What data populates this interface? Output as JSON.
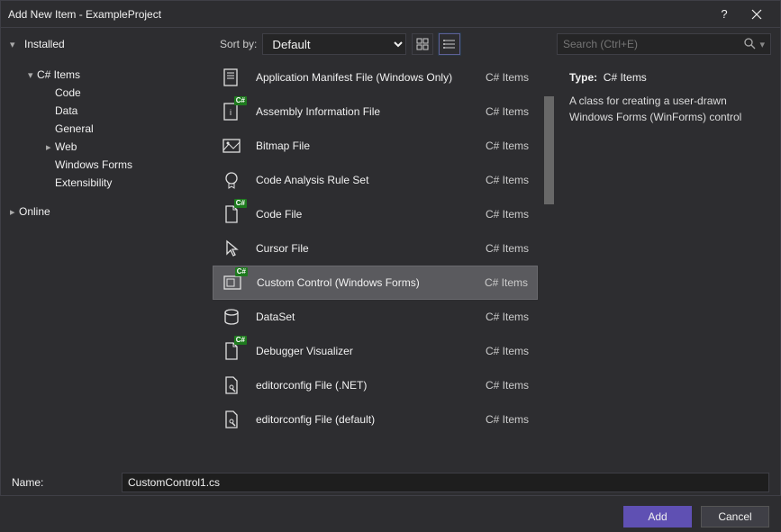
{
  "window": {
    "title": "Add New Item - ExampleProject"
  },
  "toolbar": {
    "installed_label": "Installed",
    "sort_label": "Sort by:",
    "sort_value": "Default",
    "search_placeholder": "Search (Ctrl+E)"
  },
  "tree": {
    "items": [
      {
        "label": "C# Items",
        "level": "h1",
        "arrow": "▾"
      },
      {
        "label": "Code",
        "level": "h2",
        "arrow": ""
      },
      {
        "label": "Data",
        "level": "h2",
        "arrow": ""
      },
      {
        "label": "General",
        "level": "h2",
        "arrow": ""
      },
      {
        "label": "Web",
        "level": "h2",
        "arrow": "▸"
      },
      {
        "label": "Windows Forms",
        "level": "h2",
        "arrow": ""
      },
      {
        "label": "Extensibility",
        "level": "h2",
        "arrow": ""
      }
    ],
    "online_label": "Online"
  },
  "templates": [
    {
      "label": "Application Manifest File (Windows Only)",
      "cat": "C# Items",
      "icon": "manifest",
      "cs": false
    },
    {
      "label": "Assembly Information File",
      "cat": "C# Items",
      "icon": "assembly",
      "cs": true
    },
    {
      "label": "Bitmap File",
      "cat": "C# Items",
      "icon": "bitmap",
      "cs": false
    },
    {
      "label": "Code Analysis Rule Set",
      "cat": "C# Items",
      "icon": "badge",
      "cs": false
    },
    {
      "label": "Code File",
      "cat": "C# Items",
      "icon": "file",
      "cs": true
    },
    {
      "label": "Cursor File",
      "cat": "C# Items",
      "icon": "cursor",
      "cs": false
    },
    {
      "label": "Custom Control (Windows Forms)",
      "cat": "C# Items",
      "icon": "control",
      "cs": true,
      "selected": true
    },
    {
      "label": "DataSet",
      "cat": "C# Items",
      "icon": "dataset",
      "cs": false
    },
    {
      "label": "Debugger Visualizer",
      "cat": "C# Items",
      "icon": "file",
      "cs": true
    },
    {
      "label": "editorconfig File (.NET)",
      "cat": "C# Items",
      "icon": "wrench",
      "cs": false
    },
    {
      "label": "editorconfig File (default)",
      "cat": "C# Items",
      "icon": "wrench",
      "cs": false
    }
  ],
  "details": {
    "type_label": "Type:",
    "type_value": "C# Items",
    "description": "A class for creating a user-drawn Windows Forms (WinForms) control"
  },
  "name": {
    "label": "Name:",
    "value": "CustomControl1.cs"
  },
  "footer": {
    "add": "Add",
    "cancel": "Cancel"
  }
}
